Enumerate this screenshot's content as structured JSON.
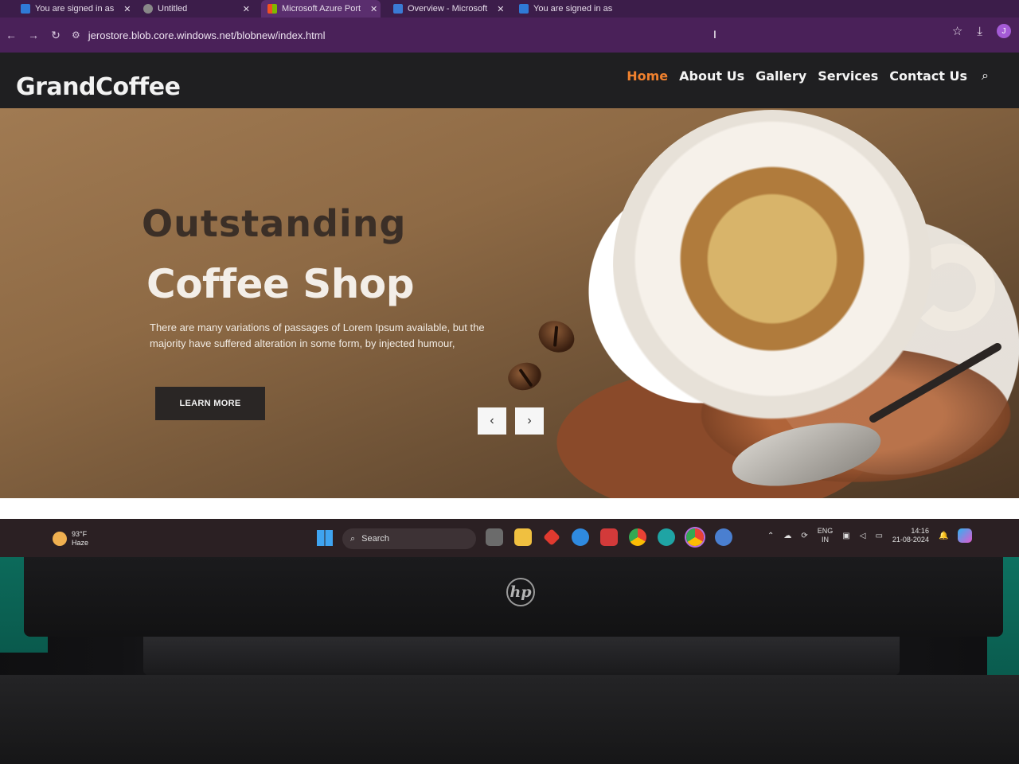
{
  "browser": {
    "tabs": [
      {
        "label": "You are signed in as",
        "icon_color": "#2f7ad6",
        "active": false
      },
      {
        "label": "Untitled",
        "icon_color": "#888888",
        "active": false
      },
      {
        "label": "Microsoft Azure Port",
        "icon_color": "#f25022",
        "active": true
      },
      {
        "label": "Overview - Microsoft",
        "icon_color": "#3a7bd5",
        "active": false
      },
      {
        "label": "You are signed in as",
        "icon_color": "#2f7ad6",
        "active": false
      }
    ],
    "url": "jerostore.blob.core.windows.net/blobnew/index.html"
  },
  "site": {
    "brand": "GrandCoffee",
    "nav": [
      "Home",
      "About Us",
      "Gallery",
      "Services",
      "Contact Us"
    ],
    "active_nav": "Home",
    "hero": {
      "kicker": "Outstanding",
      "title": "Coffee Shop",
      "text": "There are many variations of passages of Lorem Ipsum available, but the majority have suffered alteration in some form, by injected humour,",
      "button": "LEARN MORE"
    }
  },
  "taskbar": {
    "weather_temp": "93°F",
    "weather_desc": "Haze",
    "search_placeholder": "Search",
    "lang_top": "ENG",
    "lang_bottom": "IN",
    "time": "14:16",
    "date": "21-08-2024"
  },
  "colors": {
    "browser_frame": "#4a2159",
    "accent_nav": "#f0812e",
    "header_bg": "#1f1f21",
    "button_bg": "#2a2625"
  }
}
